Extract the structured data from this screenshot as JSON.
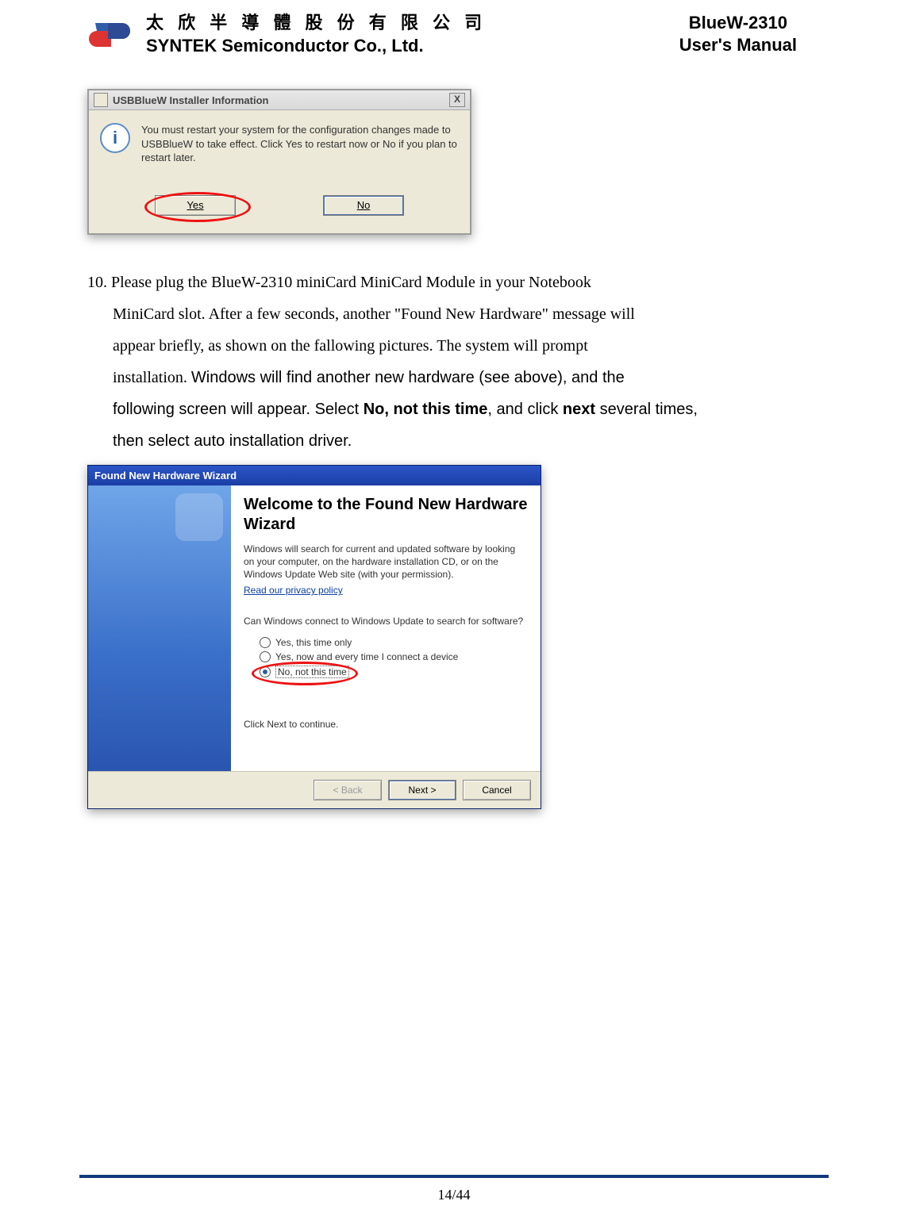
{
  "header": {
    "company_cn": "太 欣 半 導 體 股 份 有 限 公 司",
    "company_en": "SYNTEK Semiconductor Co., Ltd.",
    "doc_title_1": "BlueW-2310",
    "doc_title_2": "User's Manual"
  },
  "dialog1": {
    "title": "USBBlueW Installer Information",
    "message": "You must restart your system for the configuration changes made to USBBlueW to take effect. Click Yes to restart now or No if you plan to restart later.",
    "yes_label": "Yes",
    "no_label": "No",
    "close_label": "X"
  },
  "step10": {
    "prefix": "10. ",
    "line1": "Please plug the BlueW-2310 miniCard MiniCard Module in your Notebook",
    "line2": "MiniCard slot. After a few seconds, another \"Found New Hardware\" message will",
    "line3": "appear briefly, as shown on the fallowing pictures. The system will prompt",
    "line4a": "installation. ",
    "line4b": "Windows will find another new hardware (see above), and the",
    "line5a": "following screen will appear. Select ",
    "line5b": "No, not this time",
    "line5c": ", and click ",
    "line5d": "next",
    "line5e": " several times,",
    "line6": "then select auto installation driver."
  },
  "dialog2": {
    "title": "Found New Hardware Wizard",
    "heading": "Welcome to the Found New Hardware Wizard",
    "para1": "Windows will search for current and updated software by looking on your computer, on the hardware installation CD, or on the Windows Update Web site (with your permission).",
    "privacy_link": "Read our privacy policy",
    "para2": "Can Windows connect to Windows Update to search for software?",
    "opt1": "Yes, this time only",
    "opt2": "Yes, now and every time I connect a device",
    "opt3": "No, not this time",
    "continue": "Click Next to continue.",
    "back_label": "< Back",
    "next_label": "Next >",
    "cancel_label": "Cancel"
  },
  "footer": {
    "page_number": "14/44"
  }
}
